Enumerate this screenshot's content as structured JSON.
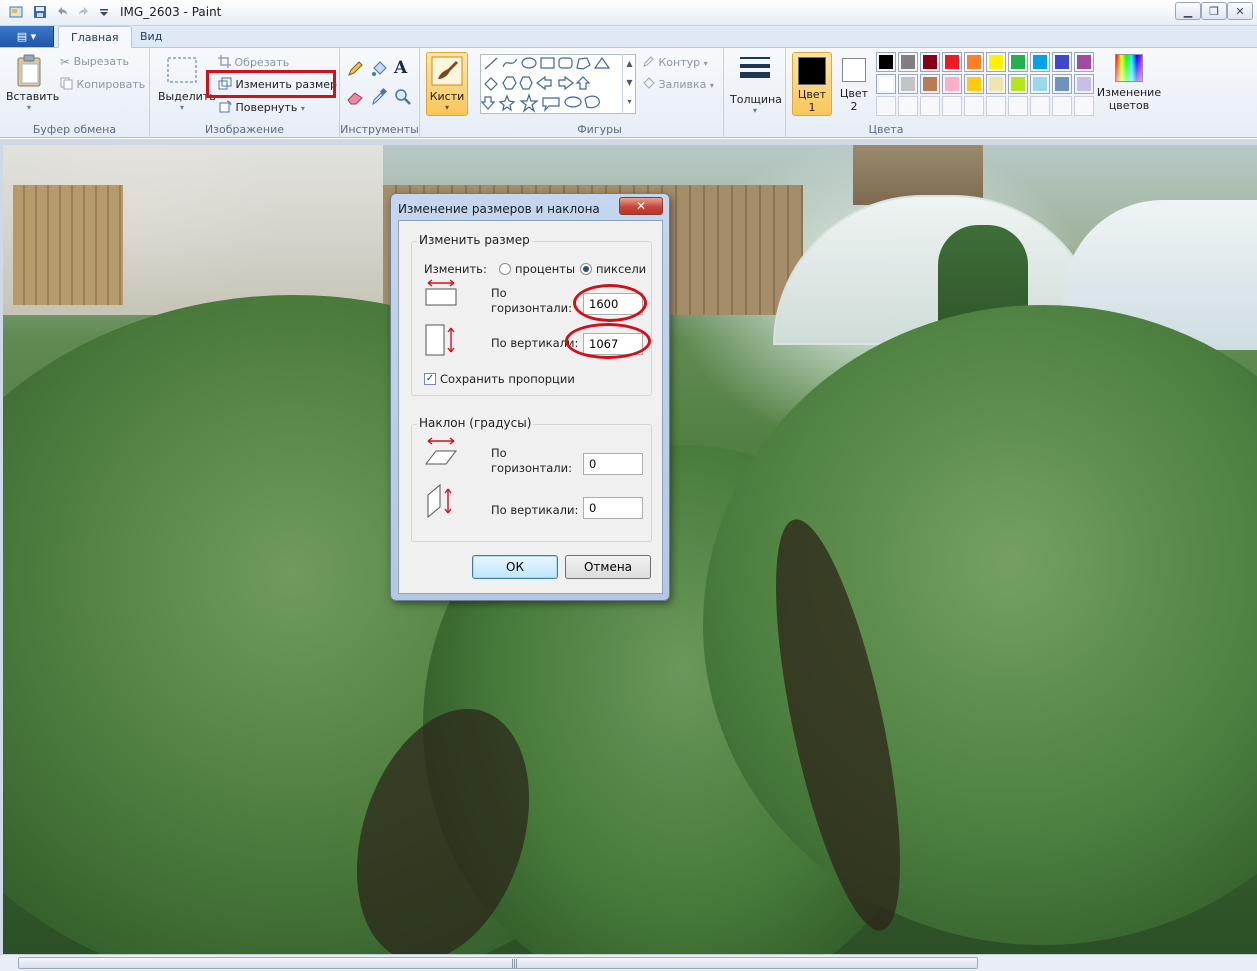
{
  "window": {
    "title": "IMG_2603 - Paint",
    "controls": {
      "minimize": "▁",
      "restore": "❐",
      "close": "✕"
    }
  },
  "tabs": {
    "file_glyph": "▤ ▾",
    "home": "Главная",
    "view": "Вид"
  },
  "ribbon": {
    "clipboard": {
      "paste": "Вставить",
      "cut": "Вырезать",
      "copy": "Копировать",
      "label": "Буфер обмена"
    },
    "image": {
      "select": "Выделить",
      "crop": "Обрезать",
      "resize": "Изменить размер",
      "rotate": "Повернуть",
      "label": "Изображение"
    },
    "tools": {
      "label": "Инструменты"
    },
    "brushes": {
      "label": "Кисти"
    },
    "shapes": {
      "outline": "Контур",
      "fill": "Заливка",
      "label": "Фигуры"
    },
    "size": {
      "label": "Толщина"
    },
    "colors": {
      "color1_label": "Цвет",
      "color1_num": "1",
      "color2_label": "Цвет",
      "color2_num": "2",
      "edit_line1": "Изменение",
      "edit_line2": "цветов",
      "label": "Цвета",
      "palette_row1": [
        "#000000",
        "#7f7f7f",
        "#880015",
        "#ed1c24",
        "#ff7f27",
        "#fff200",
        "#22b14c",
        "#00a2e8",
        "#3f48cc",
        "#a349a4"
      ],
      "palette_row2": [
        "#ffffff",
        "#c3c3c3",
        "#b97a57",
        "#ffaec9",
        "#ffc90e",
        "#efe4b0",
        "#b5e61d",
        "#99d9ea",
        "#7092be",
        "#c8bfe7"
      ],
      "color1": "#000000",
      "color2": "#ffffff"
    }
  },
  "dialog": {
    "title": "Изменение размеров и наклона",
    "close": "✕",
    "resize_group": "Изменить размер",
    "by_label": "Изменить:",
    "percent": "проценты",
    "pixels": "пиксели",
    "h_label_1": "По",
    "h_label_2": "горизонтали:",
    "h_value": "1600",
    "v_label": "По вертикали:",
    "v_value": "1067",
    "keep_ratio": "Сохранить пропорции",
    "skew_group": "Наклон (градусы)",
    "skew_h_label_1": "По",
    "skew_h_label_2": "горизонтали:",
    "skew_h_value": "0",
    "skew_v_label": "По вертикали:",
    "skew_v_value": "0",
    "ok": "ОК",
    "cancel": "Отмена"
  },
  "scrollbar": {
    "grip": "|||"
  }
}
